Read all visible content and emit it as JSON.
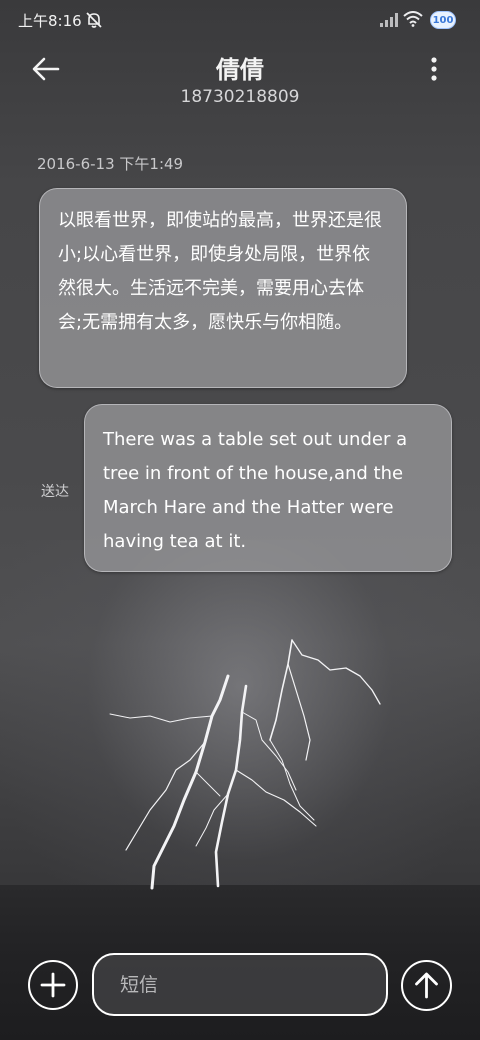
{
  "status_bar": {
    "time": "上午8:16",
    "mute_icon": "bell-off-icon",
    "signal_icon": "cellular-signal-icon",
    "wifi_icon": "wifi-icon",
    "battery_label": "100"
  },
  "header": {
    "back_icon": "arrow-left-icon",
    "contact_name": "倩倩",
    "contact_number": "18730218809",
    "more_icon": "more-vertical-icon"
  },
  "conversation": {
    "timestamp": "2016-6-13 下午1:49",
    "messages": [
      {
        "direction": "received",
        "text": "以眼看世界，即使站的最高，世界还是很小;以心看世界，即使身处局限，世界依然很大。生活远不完美，需要用心去体会;无需拥有太多，愿快乐与你相随。"
      },
      {
        "direction": "sent",
        "text": "There was a table set out under a tree in front of the house,and the March Hare and the Hatter were having tea at it.",
        "status": "送达"
      }
    ]
  },
  "composer": {
    "add_icon": "plus-icon",
    "placeholder": "短信",
    "value": "",
    "send_icon": "arrow-up-icon"
  },
  "colors": {
    "bubble": "#969698",
    "text": "#ffffff",
    "background": "#4a4a4c"
  }
}
